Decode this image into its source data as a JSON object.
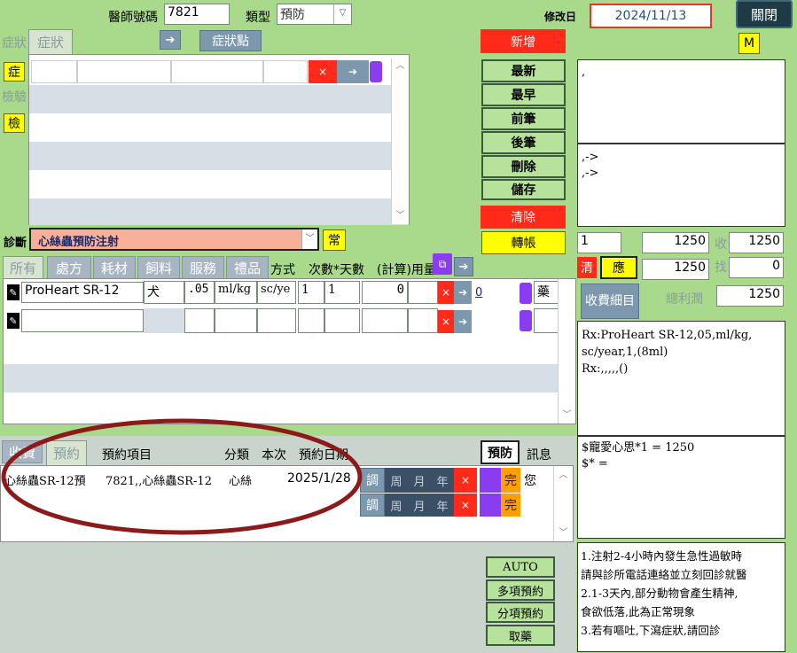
{
  "header": {
    "doctor_label": "醫師號碼",
    "doctor_value": "7821",
    "type_label": "類型",
    "type_value": "預防",
    "modified_label": "修改日",
    "modified_value": "2024/11/13",
    "close_label": "關閉",
    "m_label": "M"
  },
  "symptom": {
    "side_label_1": "症狀",
    "side_label_2": "檢驗",
    "side_btn_1": "症",
    "side_btn_2": "檢",
    "tab_label": "症狀",
    "points_label": "症狀點",
    "x_label": "×",
    "arrow_label": "➔"
  },
  "actions": {
    "add": "新增",
    "latest": "最新",
    "earliest": "最早",
    "prev": "前筆",
    "next": "後筆",
    "delete": "刪除",
    "save": "儲存",
    "clear": "清除",
    "transfer": "轉帳"
  },
  "notes": {
    "top": ",",
    "middle_1": ",->",
    "middle_2": ",->"
  },
  "diagnosis": {
    "label": "診斷",
    "value": "心絲蟲預防注射",
    "common_btn": "常"
  },
  "billing": {
    "qty": "1",
    "amount": "1250",
    "receive_label": "收",
    "receive_value": "1250",
    "clear_btn": "清",
    "due_btn": "應",
    "due_value": "1250",
    "change_label": "找",
    "change_value": "0",
    "detail_btn": "收費細目",
    "profit_label": "總利潤",
    "profit_value": "1250"
  },
  "rx_tabs": [
    "所有",
    "處方",
    "耗材",
    "飼料",
    "服務",
    "禮品"
  ],
  "rx_headers": {
    "method": "方式",
    "times_days": "次數*天數",
    "calc": "(計算)用量"
  },
  "rx_rows": [
    {
      "name": "ProHeart SR-12",
      "unit": "犬",
      "dose": ".05",
      "dose_unit": "ml/kg",
      "route": "sc/ye",
      "times": "1",
      "days": "1",
      "calc": "0",
      "link": "0",
      "flag": "藥"
    },
    {
      "name": "",
      "unit": "",
      "dose": "",
      "dose_unit": "",
      "route": "",
      "times": "",
      "days": "",
      "calc": "",
      "link": "",
      "flag": ""
    }
  ],
  "rx_text": {
    "line1": "Rx:ProHeart SR-12,05,ml/kg,",
    "line2": "sc/year,1,(8ml)",
    "line3": "Rx:,,,,,()"
  },
  "charge_text": {
    "line1": "$寵愛心思*1 = 1250",
    "line2": "$* ="
  },
  "booking": {
    "tabs": [
      "收費",
      "預約"
    ],
    "headers": {
      "item": "預約項目",
      "category": "分類",
      "this_time": "本次",
      "date": "預約日期"
    },
    "prevent_btn": "預防",
    "message_label": "訊息",
    "rows": [
      {
        "item": "心絲蟲SR-12預",
        "detail": "7821,,心絲蟲SR-12",
        "category": "心絲",
        "date": "2025/1/28",
        "adjust": "調",
        "week": "周",
        "month": "月",
        "year": "年",
        "done": "完",
        "message": "您"
      },
      {
        "item": "",
        "detail": "",
        "category": "",
        "date": "",
        "adjust": "調",
        "week": "周",
        "month": "月",
        "year": "年",
        "done": "完",
        "message": ""
      }
    ],
    "buttons": [
      "AUTO",
      "多項預約",
      "分項預約",
      "取藥"
    ]
  },
  "advice": [
    "1.注射2-4小時內發生急性過敏時",
    "請與診所電話連絡並立刻回診就醫",
    "2.1-3天內,部分動物會產生精神,",
    "食欲低落,此為正常現象",
    "3.若有嘔吐,下瀉症狀,請回診"
  ],
  "colors": {
    "background": "#a9d98b",
    "red": "#ff2a1a",
    "yellow": "#ffff00",
    "steel": "#7d98ad",
    "purple": "#8a3cf0",
    "circle": "#8b1a1a"
  }
}
